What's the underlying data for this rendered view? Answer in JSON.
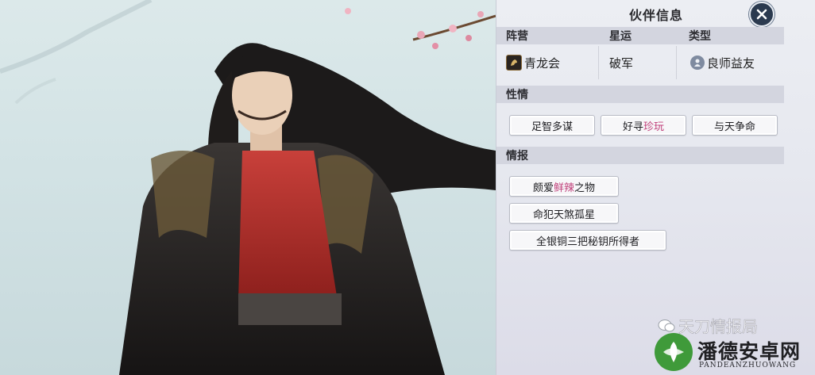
{
  "panel": {
    "title": "伙伴信息",
    "columns": [
      "阵营",
      "星运",
      "类型"
    ],
    "faction": "青龙会",
    "star_fortune": "破军",
    "type": "良师益友",
    "temperament_label": "性情",
    "temperament_tags": [
      "足智多谋",
      "好寻",
      "珍玩",
      "与天争命"
    ],
    "intel_label": "情报",
    "intel_items": [
      {
        "prefix": "颇爱",
        "highlight": "鲜辣",
        "suffix": "之物"
      },
      {
        "text": "命犯天煞孤星"
      },
      {
        "text": "全银铜三把秘钥所得者"
      }
    ]
  },
  "watermark": {
    "account": "天刀情报局",
    "site": "潘德安卓网",
    "site_pinyin": "PANDEANZHUOWANG"
  },
  "colors": {
    "highlight": "#c0407a",
    "close_button": "#2b3a4f"
  }
}
